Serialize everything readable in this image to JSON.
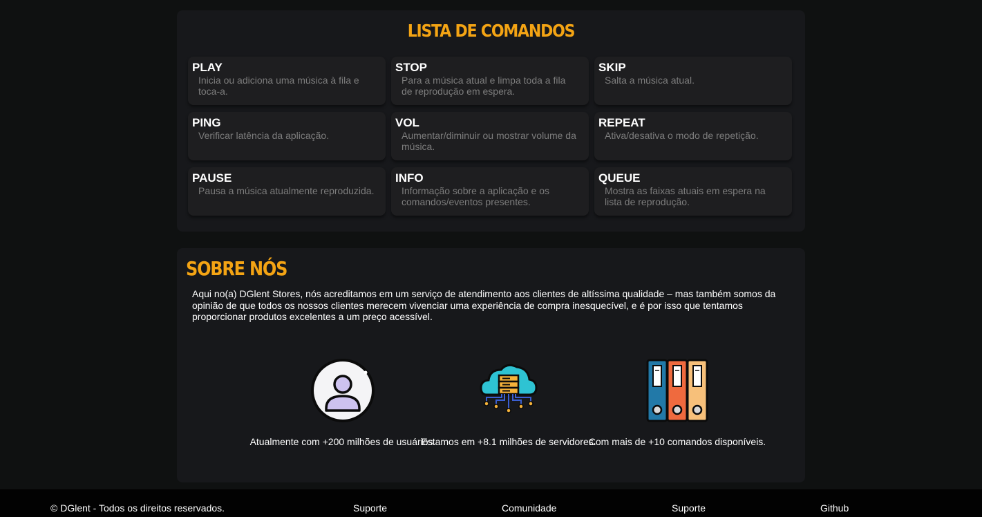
{
  "commands_section": {
    "title": "LISTA DE COMANDOS",
    "commands": [
      {
        "name": "PLAY",
        "description": "Inicia ou adiciona uma música à fila e toca-a."
      },
      {
        "name": "STOP",
        "description": "Para a música atual e limpa toda a fila de reprodução em espera."
      },
      {
        "name": "SKIP",
        "description": "Salta a música atual."
      },
      {
        "name": "PING",
        "description": "Verificar latência da aplicação."
      },
      {
        "name": "VOL",
        "description": "Aumentar/diminuir ou mostrar volume da música."
      },
      {
        "name": "REPEAT",
        "description": "Ativa/desativa o modo de repetição."
      },
      {
        "name": "PAUSE",
        "description": "Pausa a música atualmente reproduzida."
      },
      {
        "name": "INFO",
        "description": "Informação sobre a aplicação e os comandos/eventos presentes."
      },
      {
        "name": "QUEUE",
        "description": "Mostra as faixas atuais em espera na lista de reprodução."
      }
    ]
  },
  "about_section": {
    "title": "SOBRE NÓS",
    "text": "Aqui no(a) DGlent Stores, nós acreditamos em um serviço de atendimento aos clientes de altíssima qualidade – mas também somos da opinião de que todos os nossos clientes merecem vivenciar uma experiência de compra inesquecível, e é por isso que tentamos proporcionar produtos excelentes a um preço acessível.",
    "stats": [
      {
        "icon": "user-icon",
        "label": "Atualmente com +200 milhões de usuários."
      },
      {
        "icon": "cloud-server-icon",
        "label": "Estamos em +8.1 milhões de servidores."
      },
      {
        "icon": "binders-icon",
        "label": "Com mais de +10 comandos disponíveis."
      }
    ]
  },
  "footer": {
    "copyright": "© DGlent - Todos os direitos reservados.",
    "links": [
      "Suporte",
      "Comunidade",
      "Suporte",
      "Github"
    ]
  },
  "colors": {
    "accent": "#f4a414",
    "background": "#0f1111",
    "panel": "#17181b",
    "card": "#1e1e20",
    "muted_text": "#7d7d7d"
  }
}
